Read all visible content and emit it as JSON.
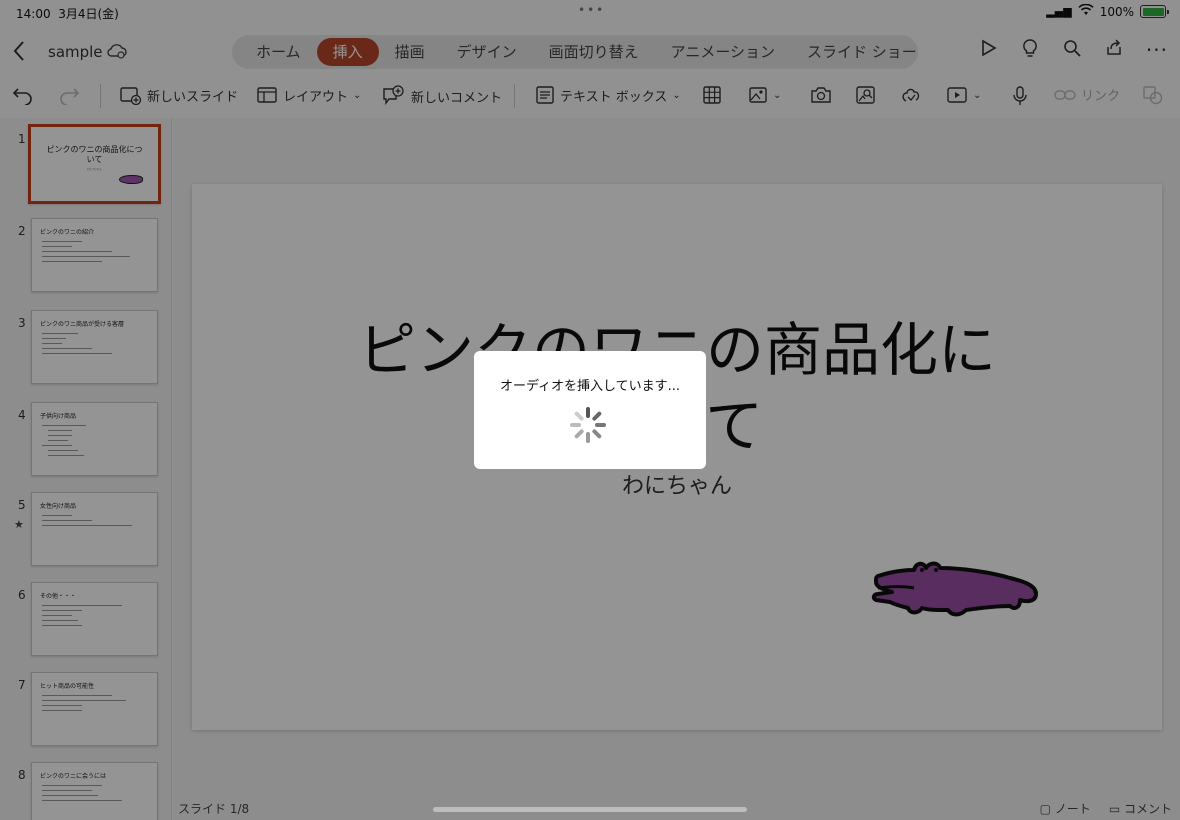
{
  "status_bar": {
    "time": "14:00",
    "date": "3月4日(金)",
    "battery": "100%",
    "battery_color": "#2fb344"
  },
  "header": {
    "back_icon": "chevron-left-icon",
    "doc_name": "sample",
    "tabs": [
      {
        "label": "ホーム",
        "active": false
      },
      {
        "label": "挿入",
        "active": true
      },
      {
        "label": "描画",
        "active": false
      },
      {
        "label": "デザイン",
        "active": false
      },
      {
        "label": "画面切り替え",
        "active": false
      },
      {
        "label": "アニメーション",
        "active": false
      },
      {
        "label": "スライド ショー",
        "active": false
      }
    ],
    "accent_color": "#b7472a"
  },
  "ribbon": {
    "new_slide": "新しいスライド",
    "layout": "レイアウト",
    "new_comment": "新しいコメント",
    "text_box": "テキスト ボックス",
    "link": "リンク"
  },
  "thumbnails": [
    {
      "num": "1",
      "title": "ピンクのワニの商品化について",
      "selected": true
    },
    {
      "num": "2",
      "title": "ピンクのワニの紹介",
      "selected": false
    },
    {
      "num": "3",
      "title": "ピンクのワニ商品が受ける客層",
      "selected": false
    },
    {
      "num": "4",
      "title": "子供向け商品",
      "selected": false
    },
    {
      "num": "5",
      "title": "女性向け商品",
      "selected": false,
      "star": "★"
    },
    {
      "num": "6",
      "title": "その他・・・",
      "selected": false
    },
    {
      "num": "7",
      "title": "ヒット商品の可能性",
      "selected": false
    },
    {
      "num": "8",
      "title": "ピンクのワニに会うには",
      "selected": false
    }
  ],
  "slide": {
    "title_line1": "ピンクのワニの商品化に",
    "title_line2": "ついて",
    "subtitle": "わにちゃん",
    "croc_color": "#9b4fa8"
  },
  "footer": {
    "slide_counter": "スライド 1/8",
    "notes": "ノート",
    "comments": "コメント"
  },
  "dialog": {
    "message": "オーディオを挿入しています..."
  }
}
